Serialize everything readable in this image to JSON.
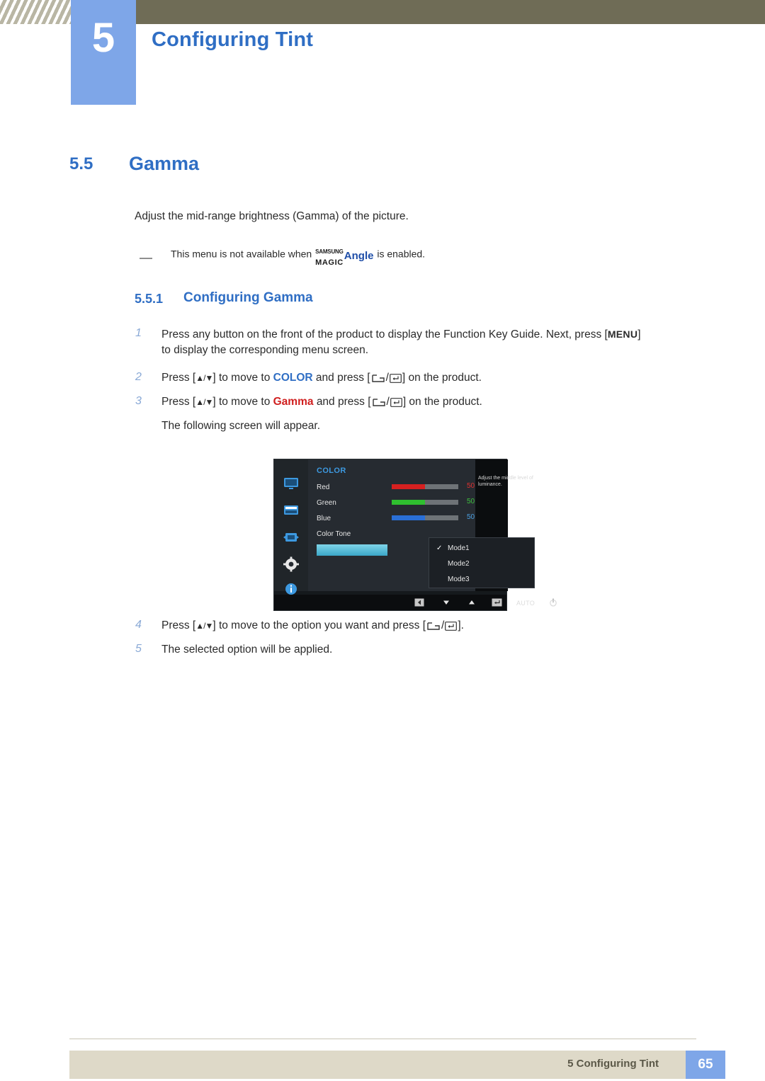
{
  "header": {
    "chapter_number": "5",
    "chapter_title": "Configuring Tint"
  },
  "section": {
    "number": "5.5",
    "title": "Gamma"
  },
  "intro": "Adjust the mid-range brightness (Gamma) of the picture.",
  "note": {
    "before": "This menu is not available when",
    "logo_samsung": "SAMSUNG",
    "logo_magic": "MAGIC",
    "logo_angle": "Angle",
    "after": "is enabled."
  },
  "subsection": {
    "number": "5.5.1",
    "title": "Configuring Gamma"
  },
  "steps": [
    {
      "number": "1",
      "text_a": "Press any button on the front of the product to display the Function Key Guide. Next, press [",
      "menu_label": "MENU",
      "text_b": "]",
      "text_line2": "to display the corresponding menu screen."
    },
    {
      "number": "2",
      "text_a": "Press [",
      "arrows": "▲/▼",
      "text_b": "] to move to",
      "keyword": "COLOR",
      "text_c": "and press [",
      "text_d": "] on the product."
    },
    {
      "number": "3",
      "text_a": "Press [",
      "arrows": "▲/▼",
      "text_b": "] to move to",
      "keyword": "Gamma",
      "text_c": "and press [",
      "text_d": "] on the product.",
      "text_line2": "The following screen will appear."
    },
    {
      "number": "4",
      "text_a": "Press [",
      "arrows": "▲/▼",
      "text_b": "] to move to the option you want and press [",
      "text_d": "]."
    },
    {
      "number": "5",
      "text_a": "The selected option will be applied."
    }
  ],
  "osd": {
    "menu_title": "COLOR",
    "rows": [
      {
        "label": "Red",
        "value": "50",
        "value_color": "#e03030",
        "bar_color": "#d62020"
      },
      {
        "label": "Green",
        "value": "50",
        "value_color": "#3ec03e",
        "bar_color": "#2fbf2f"
      },
      {
        "label": "Blue",
        "value": "50",
        "value_color": "#4a9fe0",
        "bar_color": "#2a6fd6"
      }
    ],
    "color_tone_label": "Color Tone",
    "help_text": "Adjust the middle level of luminance.",
    "submenu": [
      {
        "label": "Mode1",
        "checked": true
      },
      {
        "label": "Mode2",
        "checked": false
      },
      {
        "label": "Mode3",
        "checked": false
      }
    ],
    "footer": {
      "auto_label": "AUTO"
    },
    "sidebar_icons": [
      "monitor-icon",
      "picture-icon",
      "screen-adjust-icon",
      "settings-gear-icon",
      "information-icon"
    ]
  },
  "footer": {
    "text": "5 Configuring Tint",
    "page": "65"
  },
  "colors": {
    "accent_blue": "#2f6ec4",
    "band_olive": "#6f6c56",
    "badge_blue": "#7ea6e8",
    "footer_band": "#ded9c8"
  }
}
